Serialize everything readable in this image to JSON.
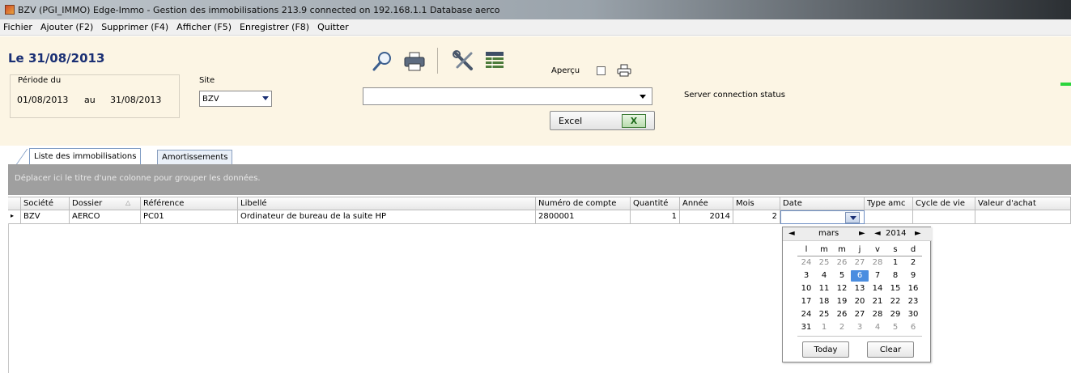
{
  "window": {
    "title": "BZV  (PGI_IMMO) Edge-Immo - Gestion des immobilisations 213.9   connected on 192.168.1.1  Database aerco"
  },
  "menu": [
    "Fichier",
    "Ajouter (F2)",
    "Supprimer (F4)",
    "Afficher (F5)",
    "Enregistrer (F8)",
    "Quitter"
  ],
  "header": {
    "date_title": "Le  31/08/2013",
    "period_label": "Période du",
    "period_from": "01/08/2013",
    "period_au": "au",
    "period_to": "31/08/2013",
    "site_label": "Site",
    "site_value": "BZV",
    "apercu_label": "Aperçu",
    "apercu_checked": false,
    "combo_value": "",
    "server_status": "Server connection status",
    "excel_label": "Excel",
    "excel_logo_text": "X",
    "icons": [
      "search-icon",
      "printer-icon",
      "tools-icon",
      "table-icon",
      "print-preview-icon"
    ]
  },
  "tabs": [
    "Liste des immobilisations",
    "Amortissements"
  ],
  "active_tab": 0,
  "group_hint": "Déplacer ici le titre d'une colonne pour grouper les données.",
  "grid": {
    "columns": [
      "Société",
      "Dossier",
      "Référence",
      "Libellé",
      "Numéro de compte",
      "Quantité",
      "Année",
      "Mois",
      "Date",
      "Type amc",
      "Cycle de vie",
      "Valeur d'achat"
    ],
    "rows": [
      [
        "BZV",
        "AERCO",
        "PC01",
        "Ordinateur de bureau de la suite HP",
        "2800001",
        "1",
        "2014",
        "2",
        "",
        "",
        "",
        ""
      ]
    ]
  },
  "calendar": {
    "month": "mars",
    "year": "2014",
    "prev_month": "◄",
    "next_month": "►",
    "prev_year": "◄",
    "next_year": "►",
    "dow": [
      "l",
      "m",
      "m",
      "j",
      "v",
      "s",
      "d"
    ],
    "weeks": [
      [
        "24",
        "25",
        "26",
        "27",
        "28",
        "1",
        "2"
      ],
      [
        "3",
        "4",
        "5",
        "6",
        "7",
        "8",
        "9"
      ],
      [
        "10",
        "11",
        "12",
        "13",
        "14",
        "15",
        "16"
      ],
      [
        "17",
        "18",
        "19",
        "20",
        "21",
        "22",
        "23"
      ],
      [
        "24",
        "25",
        "26",
        "27",
        "28",
        "29",
        "30"
      ],
      [
        "31",
        "1",
        "2",
        "3",
        "4",
        "5",
        "6"
      ]
    ],
    "selected_day": "6",
    "today_label": "Today",
    "clear_label": "Clear"
  },
  "colors": {
    "header_bg": "#fcf5e4",
    "title_blue": "#1a2f74",
    "group_panel": "#9f9f9f",
    "selected_day": "#4a8de0",
    "status_green": "#2bd53c"
  }
}
